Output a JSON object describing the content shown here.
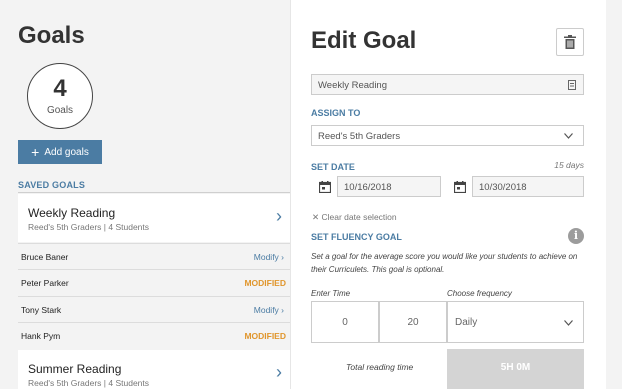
{
  "sidebar": {
    "title": "Goals",
    "count": "4",
    "count_label": "Goals",
    "add_button": "Add goals",
    "saved_label": "SAVED GOALS",
    "goals": [
      {
        "name": "Weekly Reading",
        "sub": "Reed's 5th Graders | 4 Students"
      },
      {
        "name": "Summer Reading",
        "sub": "Reed's 5th Graders | 4 Students"
      }
    ],
    "students": [
      {
        "name": "Bruce Baner",
        "status": "Modify ›"
      },
      {
        "name": "Peter Parker",
        "status": "MODIFIED"
      },
      {
        "name": "Tony Stark",
        "status": "Modify ›"
      },
      {
        "name": "Hank Pym",
        "status": "MODIFIED"
      }
    ]
  },
  "editor": {
    "title": "Edit Goal",
    "goal_name": "Weekly Reading",
    "assign_label": "ASSIGN TO",
    "assign_value": "Reed's 5th Graders",
    "set_date_label": "SET DATE",
    "days": "15 days",
    "start_date": "10/16/2018",
    "end_date": "10/30/2018",
    "clear_label": "Clear date selection",
    "fluency_label": "SET FLUENCY GOAL",
    "description": "Set a goal for the average score you would like your students to achieve on their Curriculets. This goal is optional.",
    "enter_time_label": "Enter Time",
    "frequency_label": "Choose frequency",
    "minutes": "0",
    "seconds": "20",
    "frequency": "Daily",
    "total_label": "Total reading time",
    "total_value": "5H 0M"
  },
  "colors": {
    "accent": "#4b7ca3",
    "modified": "#e0962d",
    "panel_bg": "#f3f3f3"
  },
  "icons": [
    "plus-icon",
    "chevron-right-icon",
    "trash-icon",
    "calendar-icon",
    "close-icon",
    "info-icon",
    "chevron-down-icon",
    "id-card-icon"
  ]
}
